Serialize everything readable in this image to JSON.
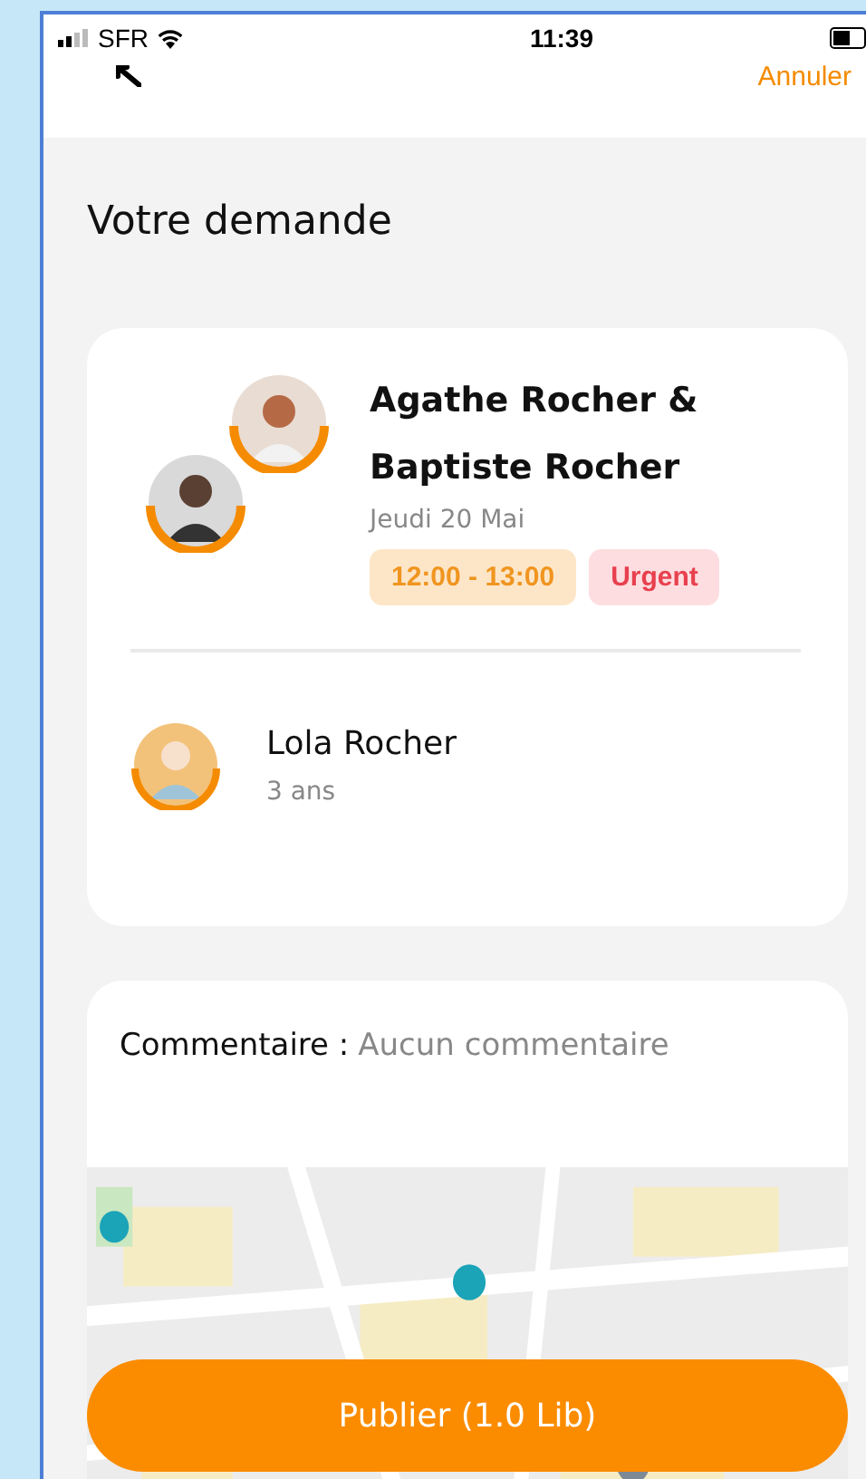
{
  "status_bar": {
    "carrier": "SFR",
    "time": "11:39"
  },
  "nav": {
    "cancel": "Annuler"
  },
  "title": "Votre demande",
  "request": {
    "names": "Agathe Rocher & Baptiste Rocher",
    "date": "Jeudi 20 Mai",
    "badges": [
      {
        "text": "12:00 - 13:00",
        "kind": "time"
      },
      {
        "text": "Urgent",
        "kind": "urgent"
      }
    ]
  },
  "children": [
    {
      "name": "Lola Rocher",
      "age": "3 ans"
    }
  ],
  "comment": {
    "label": "Commentaire :",
    "value": "Aucun commentaire"
  },
  "button": "Publier (1.0 Lib)"
}
